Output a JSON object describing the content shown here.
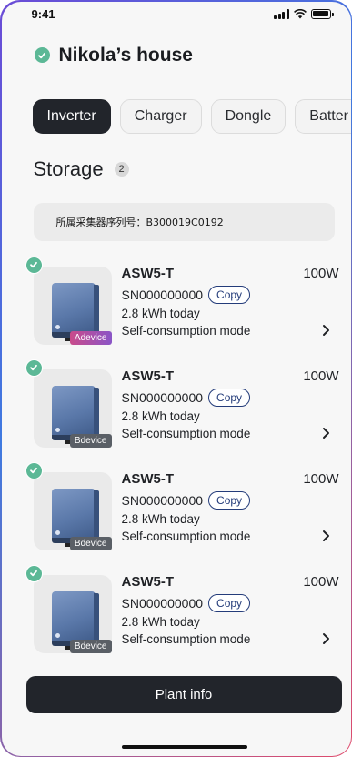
{
  "status_bar": {
    "time": "9:41"
  },
  "header": {
    "title": "Nikola’s house"
  },
  "tabs": [
    {
      "label": "Inverter",
      "active": true
    },
    {
      "label": "Charger",
      "active": false
    },
    {
      "label": "Dongle",
      "active": false
    },
    {
      "label": "Batter",
      "active": false
    }
  ],
  "section": {
    "title": "Storage",
    "count": "2"
  },
  "serial_info": {
    "text": "所属采集器序列号：B300019C0192"
  },
  "devices": [
    {
      "name": "ASW5-T",
      "power": "100W",
      "sn": "SN000000000",
      "copy_label": "Copy",
      "energy": "2.8 kWh today",
      "mode": "Self-consumption mode",
      "tag": "Adevice"
    },
    {
      "name": "ASW5-T",
      "power": "100W",
      "sn": "SN000000000",
      "copy_label": "Copy",
      "energy": "2.8 kWh today",
      "mode": "Self-consumption mode",
      "tag": "Bdevice"
    },
    {
      "name": "ASW5-T",
      "power": "100W",
      "sn": "SN000000000",
      "copy_label": "Copy",
      "energy": "2.8 kWh today",
      "mode": "Self-consumption mode",
      "tag": "Bdevice"
    },
    {
      "name": "ASW5-T",
      "power": "100W",
      "sn": "SN000000000",
      "copy_label": "Copy",
      "energy": "2.8 kWh today",
      "mode": "Self-consumption mode",
      "tag": "Bdevice"
    }
  ],
  "footer": {
    "button_label": "Plant info"
  },
  "colors": {
    "accent_dark": "#22252b",
    "status_green": "#5cb896",
    "copy_blue": "#243c7a"
  }
}
